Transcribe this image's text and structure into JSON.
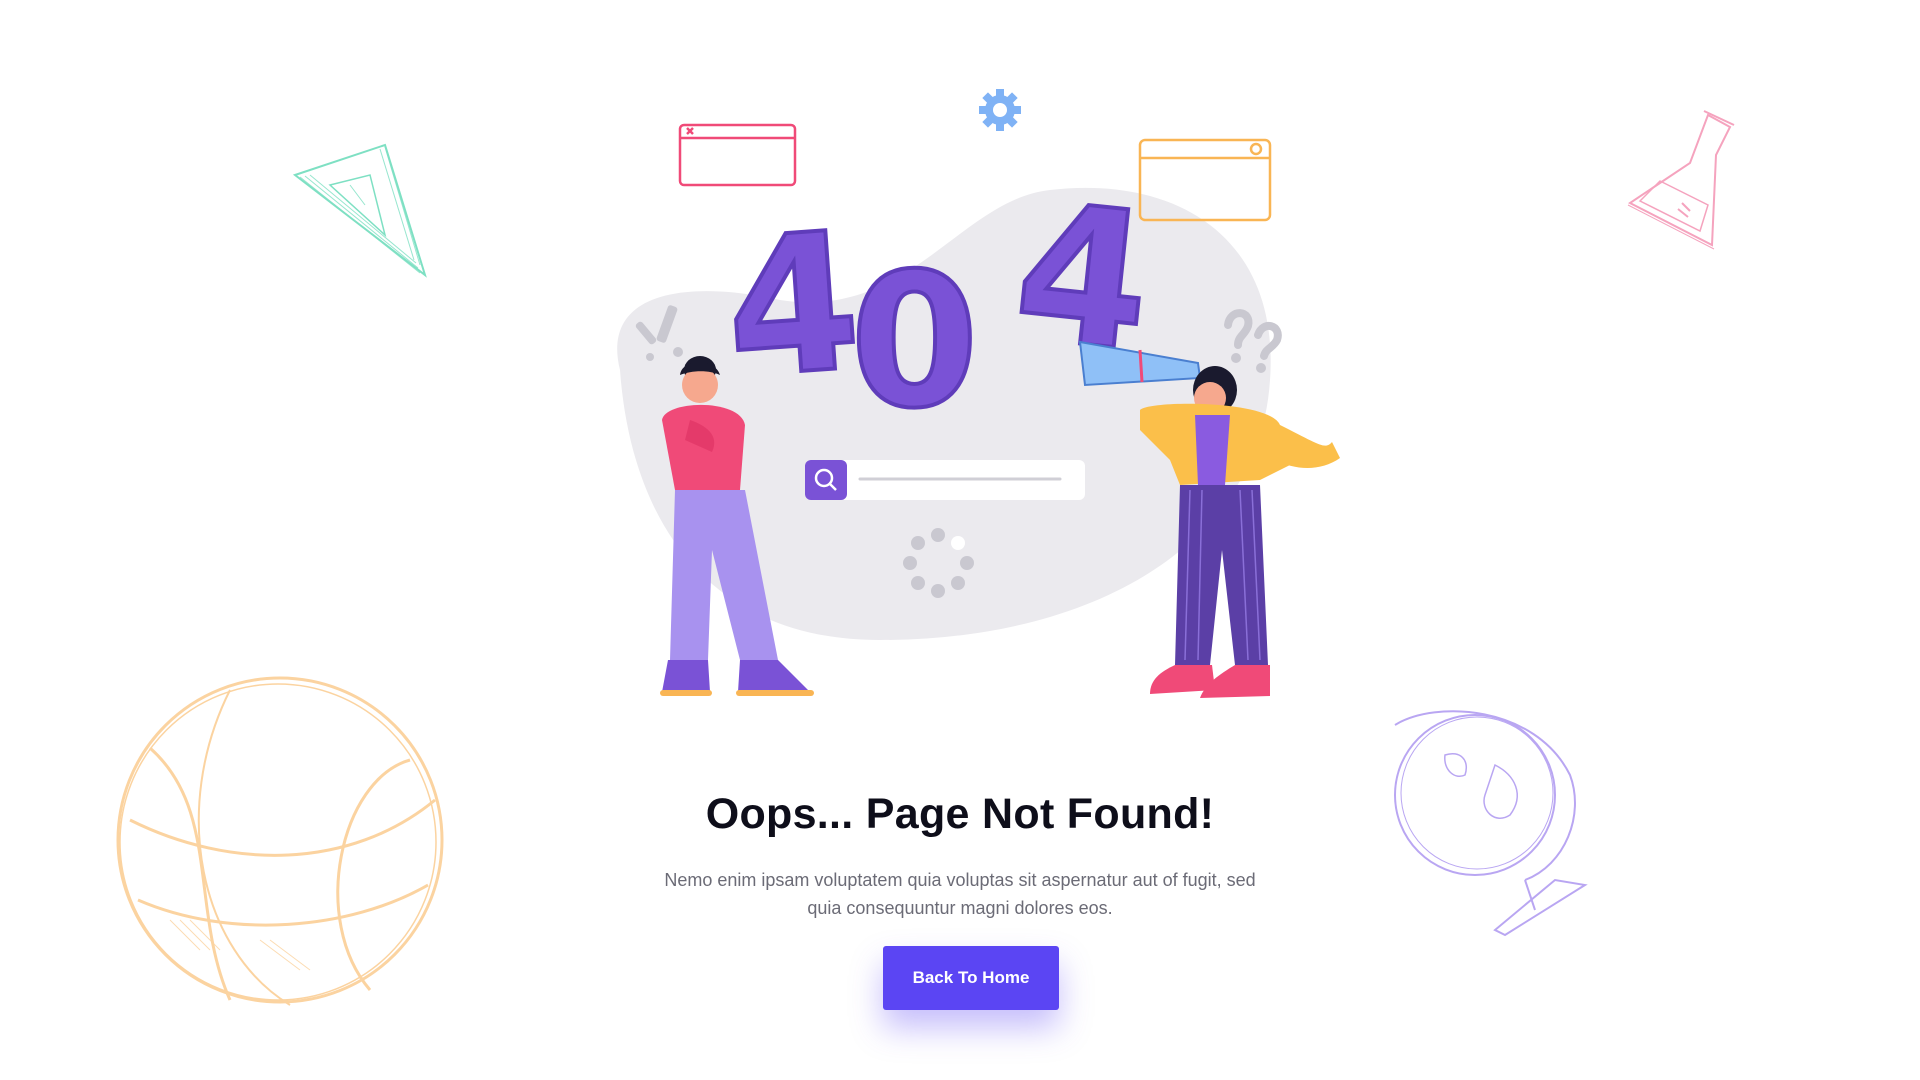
{
  "illustration": {
    "big_text": "404"
  },
  "content": {
    "title": "Oops... Page Not Found!",
    "description": "Nemo enim ipsam voluptatem quia voluptas sit aspernatur aut of fugit, sed quia consequuntur magni dolores eos.",
    "button_label": "Back To Home"
  },
  "colors": {
    "primary": "#5b45f3",
    "number_purple": "#7a52d6",
    "blob_gray": "#ebeaee",
    "triangle_green": "#7ee0c3",
    "flask_pink": "#f5a3be",
    "ball_orange": "#fbd3a0",
    "globe_purple": "#b9a6f2"
  },
  "icons": [
    "triangle-ruler-icon",
    "flask-icon",
    "basketball-icon",
    "globe-icon",
    "gear-icon",
    "browser-window-icon",
    "search-icon",
    "loading-spinner-icon"
  ]
}
